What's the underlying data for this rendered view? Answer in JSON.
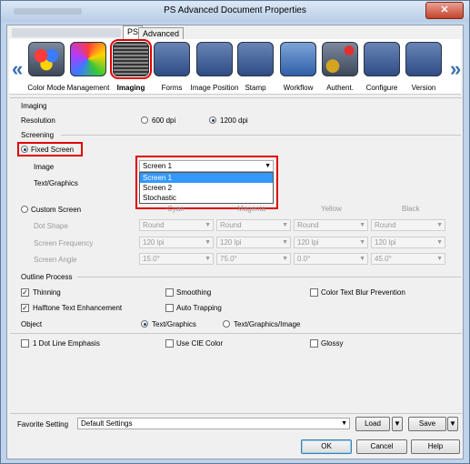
{
  "window": {
    "title": "PS Advanced Document Properties",
    "close_label": "✕"
  },
  "tabs": [
    {
      "label": "PS"
    },
    {
      "label": "Advanced"
    }
  ],
  "categories": [
    {
      "label": "Color Mode",
      "icon": "color-mode-icon"
    },
    {
      "label": "Management",
      "icon": "color-management-icon"
    },
    {
      "label": "Imaging",
      "icon": "imaging-icon",
      "selected": true
    },
    {
      "label": "Forms",
      "icon": "forms-icon"
    },
    {
      "label": "Image Position",
      "icon": "image-position-icon"
    },
    {
      "label": "Stamp",
      "icon": "stamp-icon"
    },
    {
      "label": "Workflow",
      "icon": "workflow-icon"
    },
    {
      "label": "Authent.",
      "icon": "authentication-icon"
    },
    {
      "label": "Configure",
      "icon": "configure-icon"
    },
    {
      "label": "Version",
      "icon": "version-icon"
    }
  ],
  "nav": {
    "left": "«",
    "right": "»"
  },
  "imaging": {
    "section_title": "Imaging",
    "resolution_label": "Resolution",
    "res_600": "600 dpi",
    "res_1200": "1200 dpi",
    "screening_title": "Screening",
    "fixed_screen_label": "Fixed Screen",
    "image_label": "Image",
    "text_graphics_label": "Text/Graphics",
    "image_value": "Screen 1",
    "dropdown_options": [
      "Screen 1",
      "Screen 2",
      "Stochastic"
    ],
    "custom_screen_label": "Custom Screen",
    "columns": [
      "Cyan",
      "Magenta",
      "Yellow",
      "Black"
    ],
    "dot_shape_label": "Dot Shape",
    "screen_frequency_label": "Screen Frequency",
    "screen_angle_label": "Screen Angle",
    "dot_shape_values": [
      "Round",
      "Round",
      "Round",
      "Round"
    ],
    "frequency_values": [
      "120 lpi",
      "120 lpi",
      "120 lpi",
      "120 lpi"
    ],
    "angle_values": [
      "15.0°",
      "75.0°",
      "0.0°",
      "45.0°"
    ]
  },
  "outline": {
    "title": "Outline Process",
    "thinning": "Thinning",
    "smoothing": "Smoothing",
    "color_text_blur": "Color Text Blur Prevention",
    "halftone": "Halftone Text Enhancement",
    "auto_trapping": "Auto Trapping",
    "object_label": "Object",
    "text_graphics": "Text/Graphics",
    "text_graphics_image": "Text/Graphics/Image",
    "dot_line": "1 Dot Line Emphasis",
    "use_cie": "Use CIE Color",
    "glossy": "Glossy"
  },
  "footer": {
    "favorite_label": "Favorite Setting",
    "favorite_value": "Default Settings",
    "load": "Load",
    "save": "Save",
    "ok": "OK",
    "cancel": "Cancel",
    "help": "Help"
  }
}
